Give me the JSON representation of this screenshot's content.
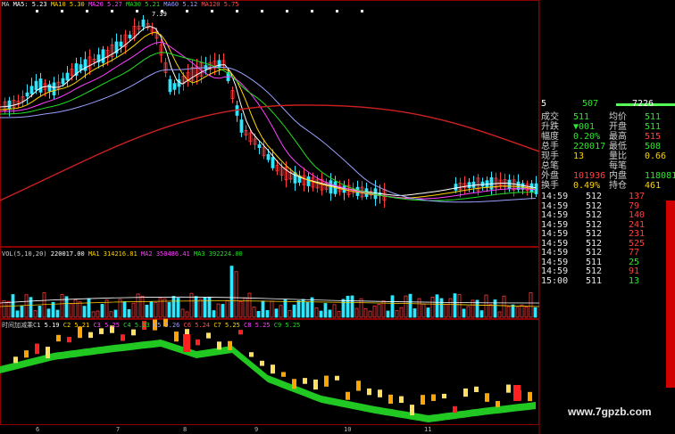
{
  "top_legend": [
    {
      "text": "MA",
      "color": "#cfcfcf"
    },
    {
      "text": "MA5: 5.23",
      "color": "#ffffff"
    },
    {
      "text": "MA10 5.30",
      "color": "#ffd400"
    },
    {
      "text": "MA20 5.27",
      "color": "#ff40ff"
    },
    {
      "text": "MA30 5.21",
      "color": "#22dd22"
    },
    {
      "text": "MA60 5.12",
      "color": "#9aa0ff"
    },
    {
      "text": "MA120 5.75",
      "color": "#ff5050"
    }
  ],
  "price_peak_label": "7.39",
  "vol_legend": [
    {
      "text": "VOL(5,10,20)",
      "color": "#cfcfcf"
    },
    {
      "text": "220017.00",
      "color": "#ffffff"
    },
    {
      "text": "MA1 314216.81",
      "color": "#ffd400"
    },
    {
      "text": "MA2 350486.41",
      "color": "#ff40ff"
    },
    {
      "text": "MA3 392224.00",
      "color": "#22dd22"
    }
  ],
  "indicator_legend": [
    {
      "text": "时间加减乘C1",
      "color": "#cfcfcf"
    },
    {
      "text": "5.19",
      "color": "#ffffff"
    },
    {
      "text": "C2 5.21",
      "color": "#ffd400"
    },
    {
      "text": "C3 5.25",
      "color": "#ff40ff"
    },
    {
      "text": "C4 5.23",
      "color": "#22dd22"
    },
    {
      "text": "C5 5.26",
      "color": "#9aa0ff"
    },
    {
      "text": "C6 5.24",
      "color": "#ff5050"
    },
    {
      "text": "C7 5.25",
      "color": "#ffd400"
    },
    {
      "text": "C8 5.25",
      "color": "#ff40ff"
    },
    {
      "text": "C9 5.25",
      "color": "#22dd22"
    }
  ],
  "panel": {
    "header": {
      "num": "5",
      "val1": "507",
      "val2": "7226"
    },
    "quote_rows": [
      {
        "l1": "成交",
        "v1": "511",
        "l2": "均价",
        "v2": "511",
        "c1": "#2ee62e",
        "c2": "#2ee62e"
      },
      {
        "l1": "升跌",
        "v1": "▼001",
        "l2": "开盘",
        "v2": "511",
        "c1": "#2ee62e",
        "c2": "#2ee62e"
      },
      {
        "l1": "幅度",
        "v1": "0.20%",
        "l2": "最高",
        "v2": "515",
        "c1": "#2ee62e",
        "c2": "#ff4040"
      },
      {
        "l1": "总手",
        "v1": "220017",
        "l2": "最低",
        "v2": "508",
        "c1": "#2ee62e",
        "c2": "#2ee62e"
      },
      {
        "l1": "现手",
        "v1": "13",
        "l2": "量比",
        "v2": "0.66",
        "c1": "#ffd400",
        "c2": "#ffd400"
      },
      {
        "l1": "总笔",
        "v1": "",
        "l2": "每笔",
        "v2": "",
        "c1": "#ffd400",
        "c2": "#ffd400"
      },
      {
        "l1": "外盘",
        "v1": "101936",
        "l2": "内盘",
        "v2": "118081",
        "c1": "#ff4040",
        "c2": "#2ee62e"
      },
      {
        "l1": "换手",
        "v1": "0.49%",
        "l2": "持仓",
        "v2": "461",
        "c1": "#ffd400",
        "c2": "#ffd400"
      }
    ],
    "ticks": [
      {
        "time": "14:59",
        "price": "512",
        "vol": "137",
        "vc": "#ff4040"
      },
      {
        "time": "14:59",
        "price": "512",
        "vol": "79",
        "vc": "#ff4040"
      },
      {
        "time": "14:59",
        "price": "512",
        "vol": "140",
        "vc": "#ff4040"
      },
      {
        "time": "14:59",
        "price": "512",
        "vol": "241",
        "vc": "#ff4040"
      },
      {
        "time": "14:59",
        "price": "512",
        "vol": "231",
        "vc": "#ff4040"
      },
      {
        "time": "14:59",
        "price": "512",
        "vol": "525",
        "vc": "#ff4040"
      },
      {
        "time": "14:59",
        "price": "512",
        "vol": "77",
        "vc": "#ff4040"
      },
      {
        "time": "14:59",
        "price": "511",
        "vol": "25",
        "vc": "#2ee62e"
      },
      {
        "time": "14:59",
        "price": "512",
        "vol": "91",
        "vc": "#ff4040"
      },
      {
        "time": "15:00",
        "price": "511",
        "vol": "13",
        "vc": "#2ee62e"
      }
    ]
  },
  "x_axis_labels": [
    "6",
    "7",
    "8",
    "9",
    "10",
    "11"
  ],
  "watermark": "www.7gpzb.com",
  "colors": {
    "up": "#ff3a3a",
    "down": "#2ee6ff",
    "grid": "#8a0000",
    "ribbon": "#22c822"
  }
}
